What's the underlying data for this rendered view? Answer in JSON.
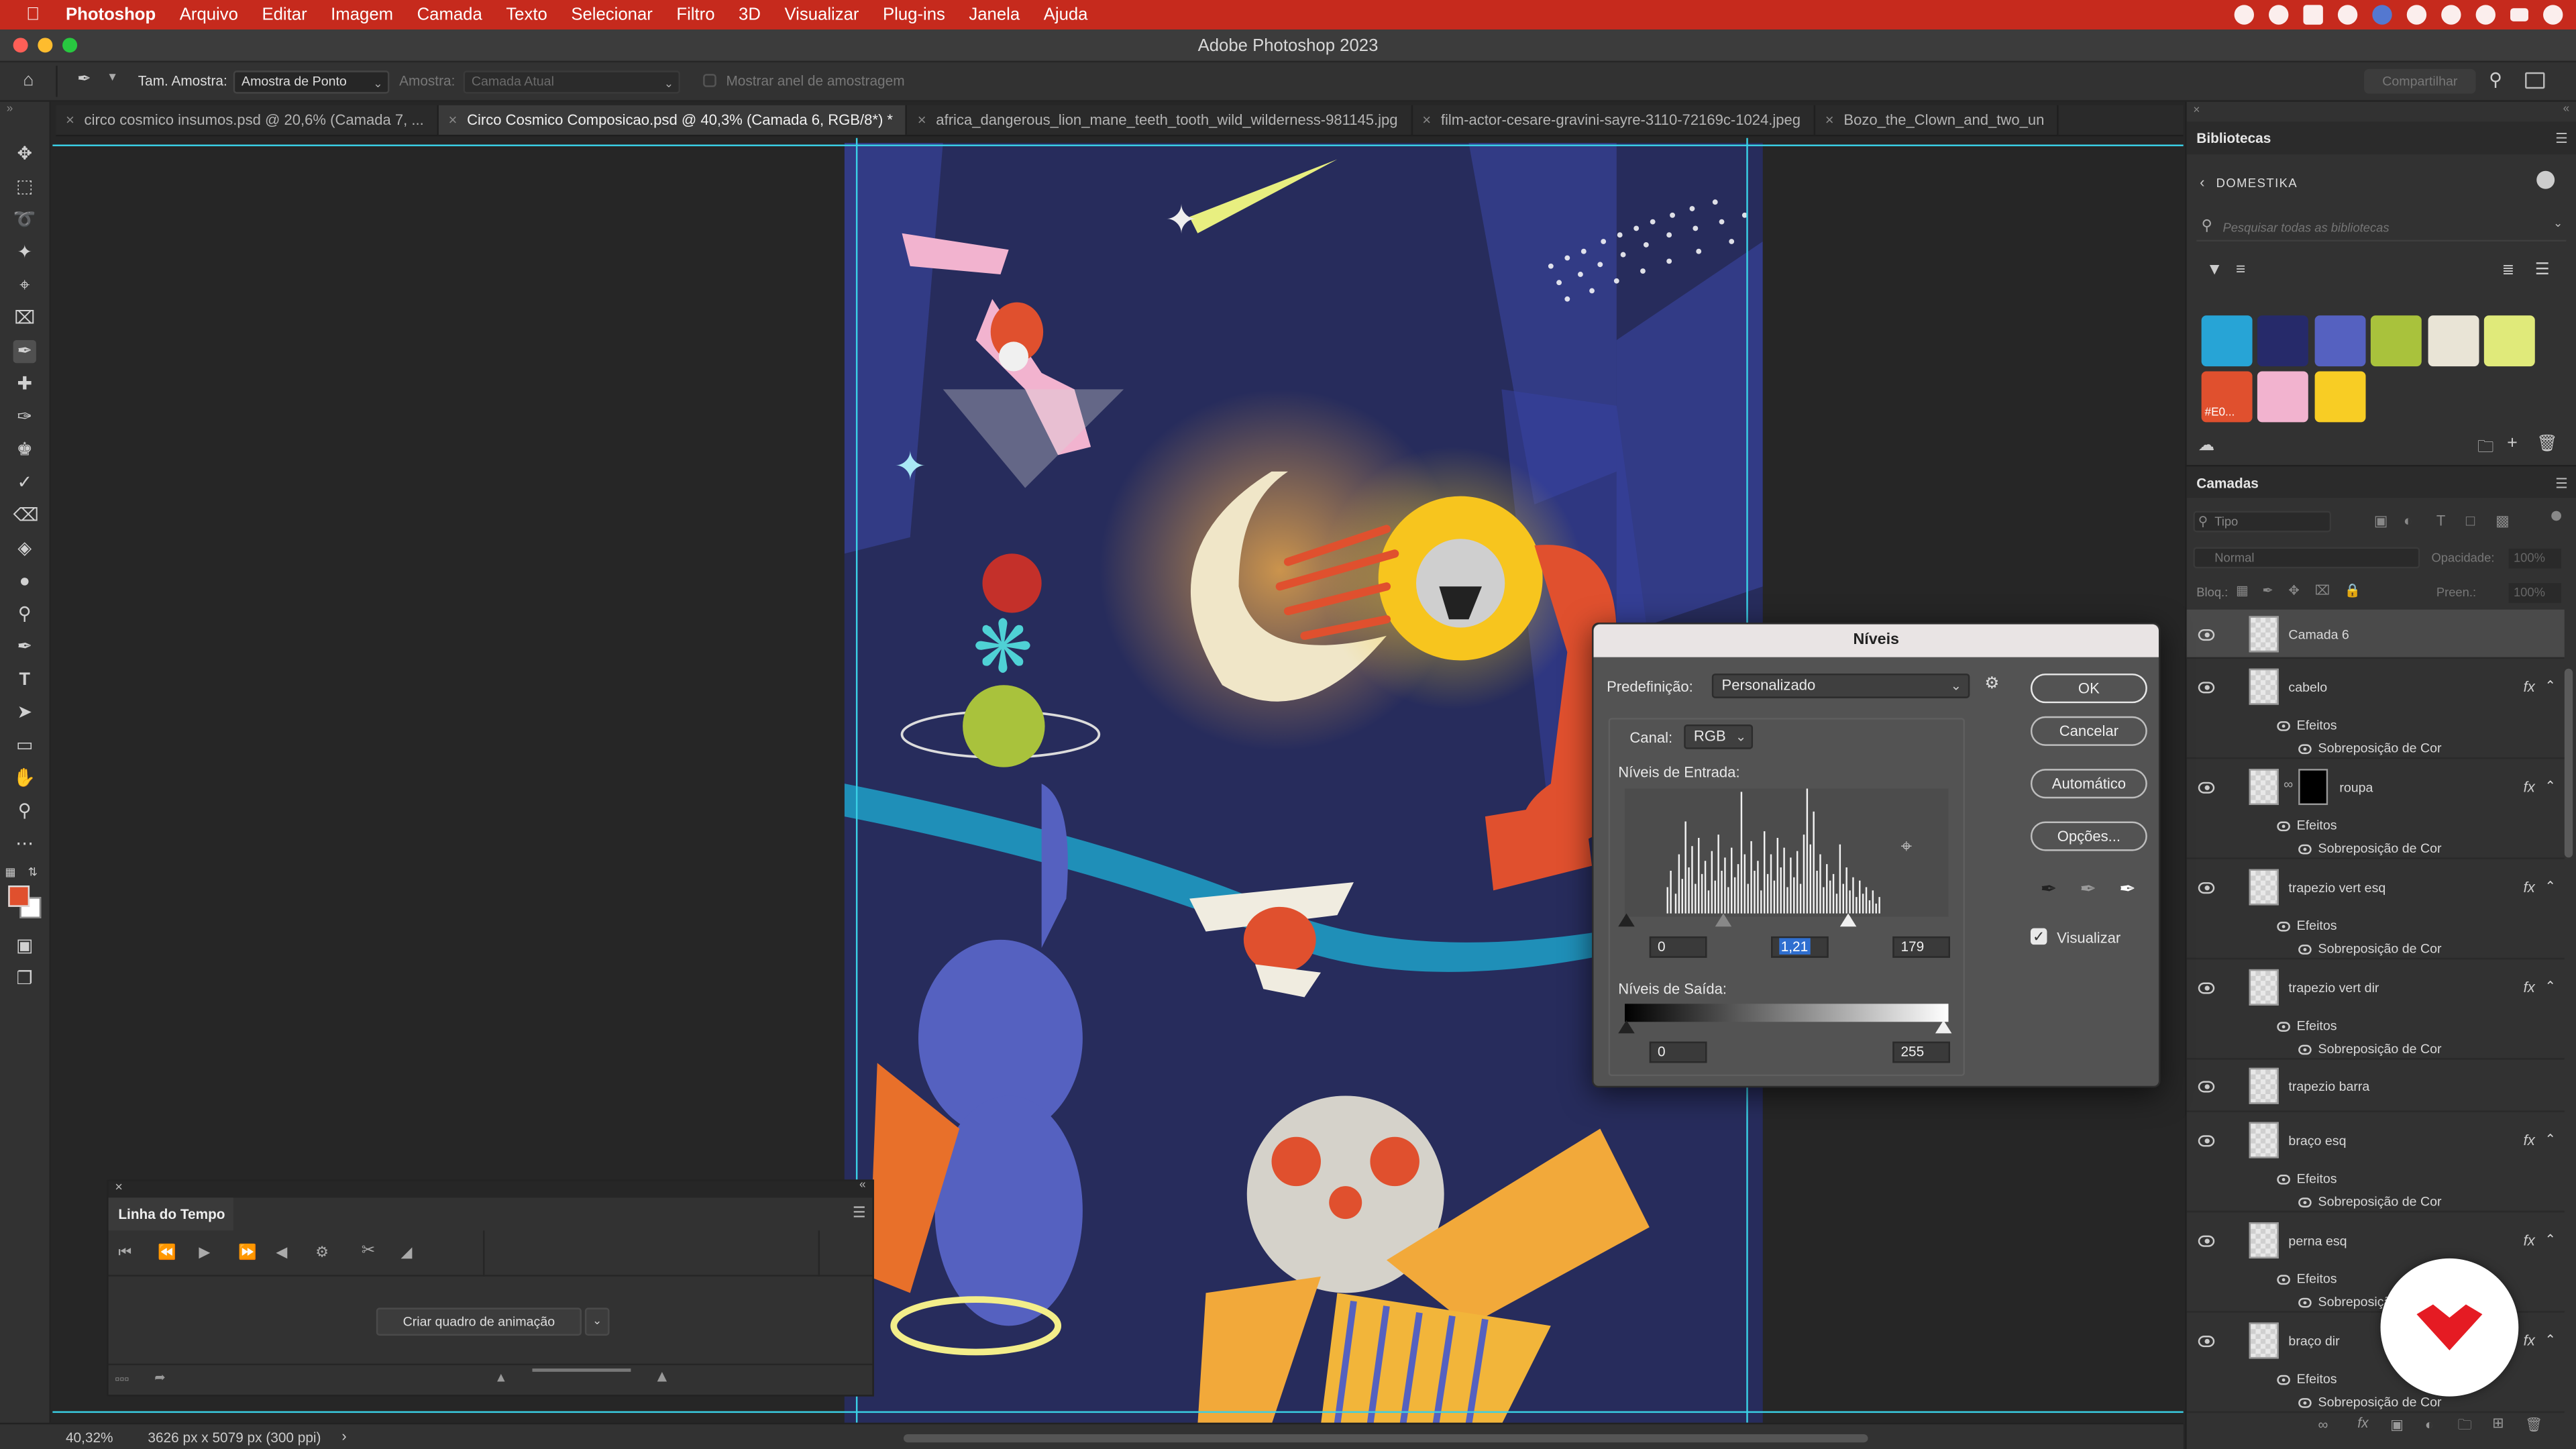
{
  "menubar": {
    "items": [
      "Photoshop",
      "Arquivo",
      "Editar",
      "Imagem",
      "Camada",
      "Texto",
      "Selecionar",
      "Filtro",
      "3D",
      "Visualizar",
      "Plug-ins",
      "Janela",
      "Ajuda"
    ]
  },
  "window": {
    "title": "Adobe Photoshop 2023"
  },
  "options": {
    "sample_size_label": "Tam. Amostra:",
    "sample_size_value": "Amostra de Ponto",
    "sample_label": "Amostra:",
    "sample_value": "Camada Atual",
    "ring_label": "Mostrar anel de amostragem",
    "share": "Compartilhar"
  },
  "tabs": [
    {
      "label": "circo cosmico insumos.psd @ 20,6% (Camada 7, ..."
    },
    {
      "label": "Circo Cosmico Composicao.psd @ 40,3% (Camada 6, RGB/8*) *"
    },
    {
      "label": "africa_dangerous_lion_mane_teeth_tooth_wild_wilderness-981145.jpg"
    },
    {
      "label": "film-actor-cesare-gravini-sayre-3110-72169c-1024.jpeg"
    },
    {
      "label": "Bozo_the_Clown_and_two_un"
    }
  ],
  "status": {
    "zoom": "40,32%",
    "doc_size": "3626 px x 5079 px (300 ppi)"
  },
  "timeline": {
    "title": "Linha do Tempo",
    "create_frame": "Criar quadro de animação"
  },
  "libraries": {
    "title": "Bibliotecas",
    "library_name": "DOMESTIKA",
    "search_placeholder": "Pesquisar todas as bibliotecas",
    "swatches": [
      {
        "color": "#27a4d6"
      },
      {
        "color": "#262a6a"
      },
      {
        "color": "#5561c0"
      },
      {
        "color": "#a9c23c"
      },
      {
        "color": "#e9e4d6"
      },
      {
        "color": "#e0ea7a"
      },
      {
        "color": "#e0502e",
        "label": "#E0..."
      },
      {
        "color": "#f2b3cf"
      },
      {
        "color": "#f8cd24"
      }
    ]
  },
  "layers": {
    "title": "Camadas",
    "kind_placeholder": "Tipo",
    "blend": "Normal",
    "opacity_label": "Opacidade:",
    "opacity_value": "100%",
    "lock_label": "Bloq.:",
    "fill_label": "Preen.:",
    "fill_value": "100%",
    "items": [
      {
        "name": "Camada 6",
        "fx": false,
        "selected": true
      },
      {
        "name": "cabelo",
        "fx": true,
        "effects": "Efeitos",
        "effect": "Sobreposição de Cor"
      },
      {
        "name": "roupa",
        "fx": true,
        "mask": true,
        "effects": "Efeitos",
        "effect": "Sobreposição de Cor"
      },
      {
        "name": "trapezio vert esq",
        "fx": true,
        "effects": "Efeitos",
        "effect": "Sobreposição de Cor"
      },
      {
        "name": "trapezio vert dir",
        "fx": true,
        "effects": "Efeitos",
        "effect": "Sobreposição de Cor"
      },
      {
        "name": "trapezio barra",
        "fx": false
      },
      {
        "name": "braço esq",
        "fx": true,
        "effects": "Efeitos",
        "effect": "Sobreposição de Cor"
      },
      {
        "name": "perna esq",
        "fx": true,
        "effects": "Efeitos",
        "effect": "Sobreposiçã"
      },
      {
        "name": "braço dir",
        "fx": true,
        "effects": "Efeitos",
        "effect": "Sobreposição de Cor"
      }
    ]
  },
  "levels": {
    "title": "Níveis",
    "preset_label": "Predefinição:",
    "preset_value": "Personalizado",
    "channel_label": "Canal:",
    "channel_value": "RGB",
    "input_label": "Níveis de Entrada:",
    "input_black": "0",
    "input_gamma": "1,21",
    "input_white": "179",
    "output_label": "Níveis de Saída:",
    "output_black": "0",
    "output_white": "255",
    "ok": "OK",
    "cancel": "Cancelar",
    "auto": "Automático",
    "options": "Opções...",
    "preview": "Visualizar"
  }
}
